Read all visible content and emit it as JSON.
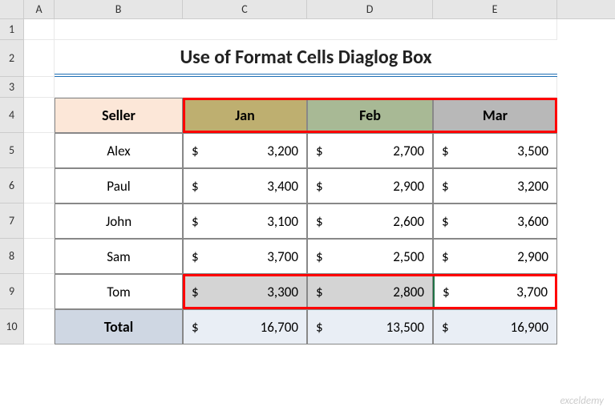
{
  "columns": [
    "A",
    "B",
    "C",
    "D",
    "E"
  ],
  "rows": [
    "1",
    "2",
    "3",
    "4",
    "5",
    "6",
    "7",
    "8",
    "9",
    "10"
  ],
  "title": "Use of Format Cells Diaglog Box",
  "headers": {
    "seller": "Seller",
    "jan": "Jan",
    "feb": "Feb",
    "mar": "Mar"
  },
  "data": [
    {
      "name": "Alex",
      "jan": "3,200",
      "feb": "2,700",
      "mar": "3,500"
    },
    {
      "name": "Paul",
      "jan": "3,400",
      "feb": "2,900",
      "mar": "3,200"
    },
    {
      "name": "John",
      "jan": "3,100",
      "feb": "2,600",
      "mar": "3,600"
    },
    {
      "name": "Sam",
      "jan": "3,700",
      "feb": "2,500",
      "mar": "2,900"
    },
    {
      "name": "Tom",
      "jan": "3,300",
      "feb": "2,800",
      "mar": "3,700"
    }
  ],
  "total": {
    "label": "Total",
    "jan": "16,700",
    "feb": "13,500",
    "mar": "16,900"
  },
  "currency": "$",
  "watermark": "exceldemy",
  "chart_data": {
    "type": "table",
    "title": "Use of Format Cells Diaglog Box",
    "columns": [
      "Seller",
      "Jan",
      "Feb",
      "Mar"
    ],
    "rows": [
      [
        "Alex",
        3200,
        2700,
        3500
      ],
      [
        "Paul",
        3400,
        2900,
        3200
      ],
      [
        "John",
        3100,
        2600,
        3600
      ],
      [
        "Sam",
        3700,
        2500,
        2900
      ],
      [
        "Tom",
        3300,
        2800,
        3700
      ],
      [
        "Total",
        16700,
        13500,
        16900
      ]
    ]
  }
}
